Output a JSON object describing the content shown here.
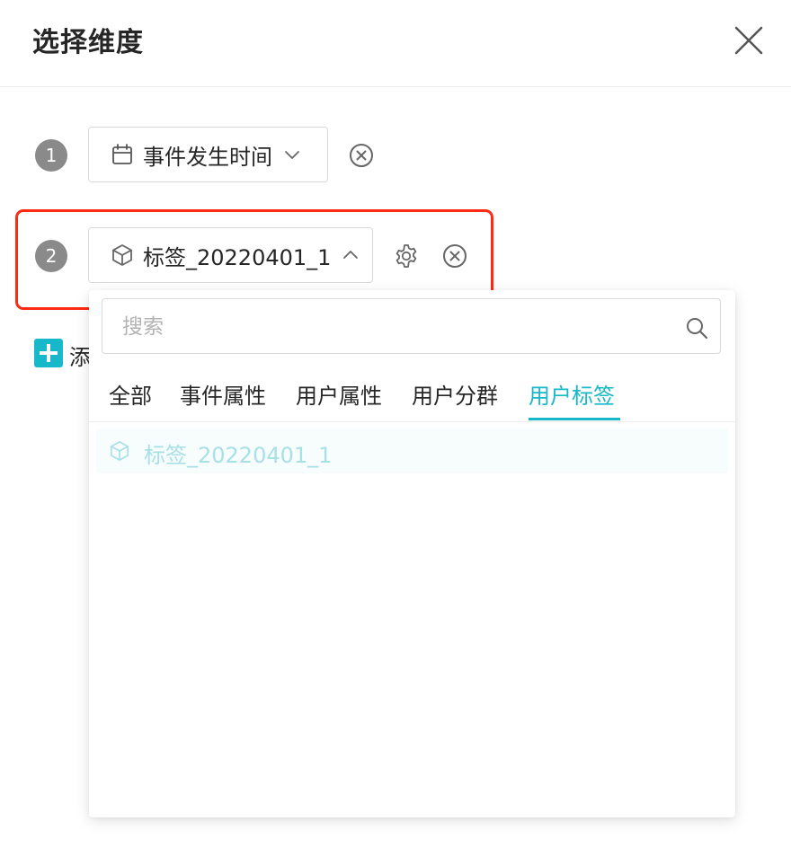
{
  "dialog": {
    "title": "选择维度",
    "close_icon": "close-icon"
  },
  "dimensions": [
    {
      "index": "1",
      "label": "事件发生时间",
      "icon": "calendar-icon",
      "expanded": false,
      "remove_icon": "remove-circle-icon"
    },
    {
      "index": "2",
      "label": "标签_20220401_1",
      "icon": "cube-icon",
      "expanded": true,
      "settings_icon": "gear-icon",
      "remove_icon": "remove-circle-icon"
    }
  ],
  "add_dimension": {
    "label": "添",
    "icon": "plus-icon"
  },
  "dropdown": {
    "search": {
      "placeholder": "搜索",
      "value": "",
      "icon": "search-icon"
    },
    "tabs": [
      {
        "label": "全部",
        "active": false
      },
      {
        "label": "事件属性",
        "active": false
      },
      {
        "label": "用户属性",
        "active": false
      },
      {
        "label": "用户分群",
        "active": false
      },
      {
        "label": "用户标签",
        "active": true
      }
    ],
    "options": [
      {
        "label": "标签_20220401_1",
        "icon": "cube-icon",
        "selected": true
      }
    ]
  },
  "colors": {
    "accent": "#17b8c9",
    "highlight_border": "#ff2a14",
    "step_badge": "#8a8a8a",
    "selected_option_text": "#a8e0e7"
  }
}
